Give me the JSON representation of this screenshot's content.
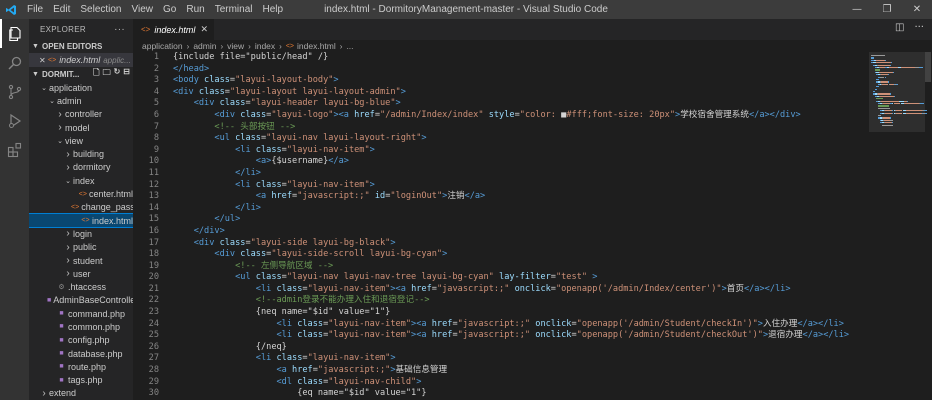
{
  "titlebar": {
    "menu": [
      "File",
      "Edit",
      "Selection",
      "View",
      "Go",
      "Run",
      "Terminal",
      "Help"
    ],
    "title": "index.html - DormitoryManagement-master - Visual Studio Code"
  },
  "colors": {
    "accent": "#007acc",
    "selection": "#094771",
    "html_icon": "#e37933",
    "php_icon": "#a074c4"
  },
  "sidebar": {
    "explorer_label": "EXPLORER",
    "open_editors_label": "OPEN EDITORS",
    "open_editor": {
      "name": "index.html",
      "path": "applic..."
    },
    "project_label": "DORMIT...",
    "tree": [
      {
        "label": "application",
        "depth": 1,
        "kind": "folder-open"
      },
      {
        "label": "admin",
        "depth": 2,
        "kind": "folder-open"
      },
      {
        "label": "controller",
        "depth": 3,
        "kind": "folder"
      },
      {
        "label": "model",
        "depth": 3,
        "kind": "folder"
      },
      {
        "label": "view",
        "depth": 3,
        "kind": "folder-open"
      },
      {
        "label": "building",
        "depth": 4,
        "kind": "folder"
      },
      {
        "label": "dormitory",
        "depth": 4,
        "kind": "folder"
      },
      {
        "label": "index",
        "depth": 4,
        "kind": "folder-open"
      },
      {
        "label": "center.html",
        "depth": 5,
        "kind": "html"
      },
      {
        "label": "change_passwor...",
        "depth": 5,
        "kind": "html"
      },
      {
        "label": "index.html",
        "depth": 5,
        "kind": "html",
        "selected": true
      },
      {
        "label": "login",
        "depth": 4,
        "kind": "folder"
      },
      {
        "label": "public",
        "depth": 4,
        "kind": "folder"
      },
      {
        "label": "student",
        "depth": 4,
        "kind": "folder"
      },
      {
        "label": "user",
        "depth": 4,
        "kind": "folder"
      },
      {
        "label": ".htaccess",
        "depth": 2,
        "kind": "config"
      },
      {
        "label": "AdminBaseControlle...",
        "depth": 2,
        "kind": "php"
      },
      {
        "label": "command.php",
        "depth": 2,
        "kind": "php"
      },
      {
        "label": "common.php",
        "depth": 2,
        "kind": "php"
      },
      {
        "label": "config.php",
        "depth": 2,
        "kind": "php"
      },
      {
        "label": "database.php",
        "depth": 2,
        "kind": "php"
      },
      {
        "label": "route.php",
        "depth": 2,
        "kind": "php"
      },
      {
        "label": "tags.php",
        "depth": 2,
        "kind": "php"
      },
      {
        "label": "extend",
        "depth": 1,
        "kind": "folder"
      }
    ]
  },
  "tab": {
    "label": "index.html"
  },
  "breadcrumb": [
    "application",
    "admin",
    "view",
    "index",
    "index.html",
    "..."
  ],
  "editor": {
    "lines": [
      [
        [
          "t-text",
          "{include file=\"public/head\" /}"
        ]
      ],
      [
        [
          "t-tag",
          "</head>"
        ]
      ],
      [
        [
          "t-tag",
          "<body "
        ],
        [
          "t-attr",
          "class"
        ],
        [
          "t-text",
          "="
        ],
        [
          "t-str",
          "\"layui-layout-body\""
        ],
        [
          "t-tag",
          ">"
        ]
      ],
      [
        [
          "t-tag",
          "<div "
        ],
        [
          "t-attr",
          "class"
        ],
        [
          "t-text",
          "="
        ],
        [
          "t-str",
          "\"layui-layout layui-layout-admin\""
        ],
        [
          "t-tag",
          ">"
        ]
      ],
      [
        [
          "t-text",
          "    "
        ],
        [
          "t-tag",
          "<div "
        ],
        [
          "t-attr",
          "class"
        ],
        [
          "t-text",
          "="
        ],
        [
          "t-str",
          "\"layui-header layui-bg-blue\""
        ],
        [
          "t-tag",
          ">"
        ]
      ],
      [
        [
          "t-text",
          "        "
        ],
        [
          "t-tag",
          "<div "
        ],
        [
          "t-attr",
          "class"
        ],
        [
          "t-text",
          "="
        ],
        [
          "t-str",
          "\"layui-logo\""
        ],
        [
          "t-tag",
          "><a "
        ],
        [
          "t-attr",
          "href"
        ],
        [
          "t-text",
          "="
        ],
        [
          "t-str",
          "\"/admin/Index/index\""
        ],
        [
          "t-text",
          " "
        ],
        [
          "t-attr",
          "style"
        ],
        [
          "t-text",
          "="
        ],
        [
          "t-str",
          "\"color: "
        ],
        [
          "t-text",
          "■"
        ],
        [
          "t-str",
          "#fff;font-size: 20px\""
        ],
        [
          "t-tag",
          ">"
        ],
        [
          "t-text",
          "学校宿舍管理系统"
        ],
        [
          "t-tag",
          "</a></div>"
        ]
      ],
      [
        [
          "t-text",
          "        "
        ],
        [
          "t-com",
          "<!-- 头部按钮 -->"
        ]
      ],
      [
        [
          "t-text",
          "        "
        ],
        [
          "t-tag",
          "<ul "
        ],
        [
          "t-attr",
          "class"
        ],
        [
          "t-text",
          "="
        ],
        [
          "t-str",
          "\"layui-nav layui-layout-right\""
        ],
        [
          "t-tag",
          ">"
        ]
      ],
      [
        [
          "t-text",
          "            "
        ],
        [
          "t-tag",
          "<li "
        ],
        [
          "t-attr",
          "class"
        ],
        [
          "t-text",
          "="
        ],
        [
          "t-str",
          "\"layui-nav-item\""
        ],
        [
          "t-tag",
          ">"
        ]
      ],
      [
        [
          "t-text",
          "                "
        ],
        [
          "t-tag",
          "<a>"
        ],
        [
          "t-text",
          "{$username}"
        ],
        [
          "t-tag",
          "</a>"
        ]
      ],
      [
        [
          "t-text",
          "            "
        ],
        [
          "t-tag",
          "</li>"
        ]
      ],
      [
        [
          "t-text",
          "            "
        ],
        [
          "t-tag",
          "<li "
        ],
        [
          "t-attr",
          "class"
        ],
        [
          "t-text",
          "="
        ],
        [
          "t-str",
          "\"layui-nav-item\""
        ],
        [
          "t-tag",
          ">"
        ]
      ],
      [
        [
          "t-text",
          "                "
        ],
        [
          "t-tag",
          "<a "
        ],
        [
          "t-attr",
          "href"
        ],
        [
          "t-text",
          "="
        ],
        [
          "t-str",
          "\"javascript:;\""
        ],
        [
          "t-text",
          " "
        ],
        [
          "t-attr",
          "id"
        ],
        [
          "t-text",
          "="
        ],
        [
          "t-str",
          "\"loginOut\""
        ],
        [
          "t-tag",
          ">"
        ],
        [
          "t-text",
          "注销"
        ],
        [
          "t-tag",
          "</a>"
        ]
      ],
      [
        [
          "t-text",
          "            "
        ],
        [
          "t-tag",
          "</li>"
        ]
      ],
      [
        [
          "t-text",
          "        "
        ],
        [
          "t-tag",
          "</ul>"
        ]
      ],
      [
        [
          "t-text",
          "    "
        ],
        [
          "t-tag",
          "</div>"
        ]
      ],
      [
        [
          "t-text",
          "    "
        ],
        [
          "t-tag",
          "<div "
        ],
        [
          "t-attr",
          "class"
        ],
        [
          "t-text",
          "="
        ],
        [
          "t-str",
          "\"layui-side layui-bg-black\""
        ],
        [
          "t-tag",
          ">"
        ]
      ],
      [
        [
          "t-text",
          "        "
        ],
        [
          "t-tag",
          "<div "
        ],
        [
          "t-attr",
          "class"
        ],
        [
          "t-text",
          "="
        ],
        [
          "t-str",
          "\"layui-side-scroll layui-bg-cyan\""
        ],
        [
          "t-tag",
          ">"
        ]
      ],
      [
        [
          "t-text",
          "            "
        ],
        [
          "t-com",
          "<!-- 左侧导航区域 -->"
        ]
      ],
      [
        [
          "t-text",
          "            "
        ],
        [
          "t-tag",
          "<ul "
        ],
        [
          "t-attr",
          "class"
        ],
        [
          "t-text",
          "="
        ],
        [
          "t-str",
          "\"layui-nav layui-nav-tree layui-bg-cyan\""
        ],
        [
          "t-text",
          " "
        ],
        [
          "t-attr",
          "lay-filter"
        ],
        [
          "t-text",
          "="
        ],
        [
          "t-str",
          "\"test\""
        ],
        [
          "t-text",
          " "
        ],
        [
          "t-tag",
          ">"
        ]
      ],
      [
        [
          "t-text",
          "                "
        ],
        [
          "t-tag",
          "<li "
        ],
        [
          "t-attr",
          "class"
        ],
        [
          "t-text",
          "="
        ],
        [
          "t-str",
          "\"layui-nav-item\""
        ],
        [
          "t-tag",
          "><a "
        ],
        [
          "t-attr",
          "href"
        ],
        [
          "t-text",
          "="
        ],
        [
          "t-str",
          "\"javascript:;\""
        ],
        [
          "t-text",
          " "
        ],
        [
          "t-attr",
          "onclick"
        ],
        [
          "t-text",
          "="
        ],
        [
          "t-str",
          "\"openapp('/admin/Index/center')\""
        ],
        [
          "t-tag",
          ">"
        ],
        [
          "t-text",
          "首页"
        ],
        [
          "t-tag",
          "</a></li>"
        ]
      ],
      [
        [
          "t-text",
          "                "
        ],
        [
          "t-com",
          "<!--admin登录不能办理入住和退宿登记-->"
        ]
      ],
      [
        [
          "t-text",
          "                "
        ],
        [
          "t-text",
          "{neq name=\"$id\" value=\"1\"}"
        ]
      ],
      [
        [
          "t-text",
          "                    "
        ],
        [
          "t-tag",
          "<li "
        ],
        [
          "t-attr",
          "class"
        ],
        [
          "t-text",
          "="
        ],
        [
          "t-str",
          "\"layui-nav-item\""
        ],
        [
          "t-tag",
          "><a "
        ],
        [
          "t-attr",
          "href"
        ],
        [
          "t-text",
          "="
        ],
        [
          "t-str",
          "\"javascript:;\""
        ],
        [
          "t-text",
          " "
        ],
        [
          "t-attr",
          "onclick"
        ],
        [
          "t-text",
          "="
        ],
        [
          "t-str",
          "\"openapp('/admin/Student/checkIn')\""
        ],
        [
          "t-tag",
          ">"
        ],
        [
          "t-text",
          "入住办理"
        ],
        [
          "t-tag",
          "</a></li>"
        ]
      ],
      [
        [
          "t-text",
          "                    "
        ],
        [
          "t-tag",
          "<li "
        ],
        [
          "t-attr",
          "class"
        ],
        [
          "t-text",
          "="
        ],
        [
          "t-str",
          "\"layui-nav-item\""
        ],
        [
          "t-tag",
          "><a "
        ],
        [
          "t-attr",
          "href"
        ],
        [
          "t-text",
          "="
        ],
        [
          "t-str",
          "\"javascript:;\""
        ],
        [
          "t-text",
          " "
        ],
        [
          "t-attr",
          "onclick"
        ],
        [
          "t-text",
          "="
        ],
        [
          "t-str",
          "\"openapp('/admin/Student/checkOut')\""
        ],
        [
          "t-tag",
          ">"
        ],
        [
          "t-text",
          "退宿办理"
        ],
        [
          "t-tag",
          "</a></li>"
        ]
      ],
      [
        [
          "t-text",
          "                "
        ],
        [
          "t-text",
          "{/neq}"
        ]
      ],
      [
        [
          "t-text",
          "                "
        ],
        [
          "t-tag",
          "<li "
        ],
        [
          "t-attr",
          "class"
        ],
        [
          "t-text",
          "="
        ],
        [
          "t-str",
          "\"layui-nav-item\""
        ],
        [
          "t-tag",
          ">"
        ]
      ],
      [
        [
          "t-text",
          "                    "
        ],
        [
          "t-tag",
          "<a "
        ],
        [
          "t-attr",
          "href"
        ],
        [
          "t-text",
          "="
        ],
        [
          "t-str",
          "\"javascript:;\""
        ],
        [
          "t-tag",
          ">"
        ],
        [
          "t-text",
          "基础信息管理"
        ]
      ],
      [
        [
          "t-text",
          "                    "
        ],
        [
          "t-tag",
          "<dl "
        ],
        [
          "t-attr",
          "class"
        ],
        [
          "t-text",
          "="
        ],
        [
          "t-str",
          "\"layui-nav-child\""
        ],
        [
          "t-tag",
          ">"
        ]
      ],
      [
        [
          "t-text",
          "                        "
        ],
        [
          "t-text",
          "{eq name=\"$id\" value=\"1\"}"
        ]
      ]
    ]
  }
}
